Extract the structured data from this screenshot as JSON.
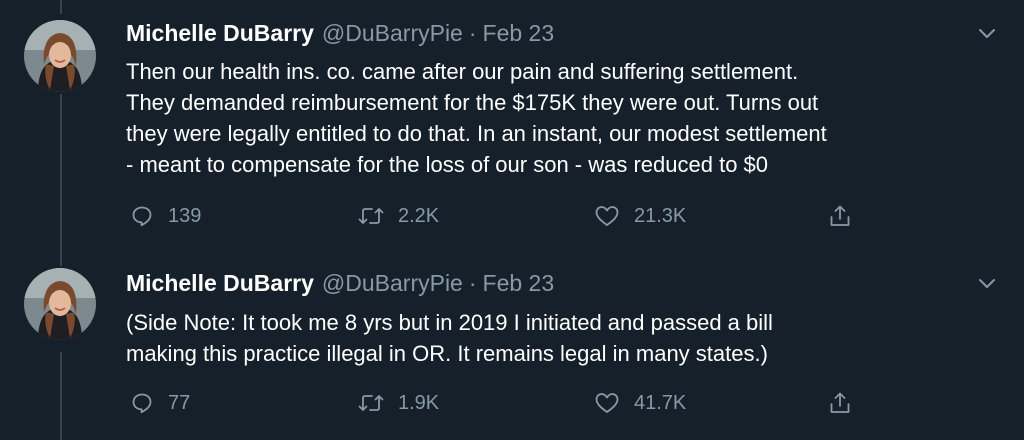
{
  "tweets": [
    {
      "name": "Michelle DuBarry",
      "handle": "@DuBarryPie",
      "separator": "·",
      "date": "Feb 23",
      "lines": [
        "Then our health ins. co. came after our pain and suffering settlement.",
        "They demanded reimbursement for the $175K they were out. Turns out",
        "they were legally entitled to do that. In an instant, our modest settlement",
        "- meant to compensate for the loss of our son - was reduced to $0"
      ],
      "replies": "139",
      "retweets": "2.2K",
      "likes": "21.3K"
    },
    {
      "name": "Michelle DuBarry",
      "handle": "@DuBarryPie",
      "separator": "·",
      "date": "Feb 23",
      "lines": [
        "(Side Note: It took me 8 yrs but in 2019 I initiated and passed a bill",
        "making this practice illegal in OR. It remains legal in many states.)"
      ],
      "replies": "77",
      "retweets": "1.9K",
      "likes": "41.7K"
    }
  ],
  "icons": {
    "reply": "reply-icon",
    "retweet": "retweet-icon",
    "like": "heart-icon",
    "share": "share-icon",
    "caret": "chevron-down-icon"
  },
  "colors": {
    "background": "#15202b",
    "secondary_text": "#8899a6",
    "thread_line": "#38444d"
  }
}
